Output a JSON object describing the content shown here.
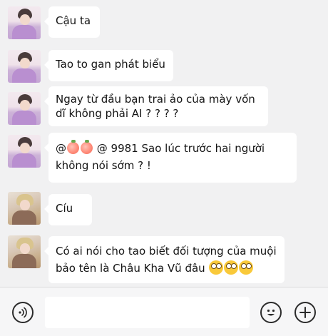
{
  "messages": [
    {
      "avatar": "purple",
      "lines": [
        "Cậu ta"
      ]
    },
    {
      "avatar": "purple",
      "lines": [
        "Tao to gan phát biểu"
      ]
    },
    {
      "avatar": "purple",
      "lines": [
        "Ngay từ đầu bạn trai ảo của mày vốn",
        "dĩ không phải AI ? ? ? ?"
      ]
    },
    {
      "avatar": "purple",
      "mention_prefix": "@",
      "mention_suffix": "@ 9981   Sao lúc trước hai người",
      "lines": [
        "không nói sớm ? !"
      ]
    },
    {
      "avatar": "gold",
      "lines": [
        "Cíu"
      ]
    },
    {
      "avatar": "gold",
      "lines": [
        "Có ai nói cho tao biết đối tượng của muội",
        "bảo tên là Châu Kha Vũ đâu"
      ]
    }
  ],
  "icons": {
    "voice": "voice-icon",
    "emoji": "emoji-icon",
    "plus": "plus-icon",
    "peach": "peach-emoji",
    "eye_roll": "eye-roll-emoji"
  },
  "input": {
    "value": "",
    "placeholder": ""
  },
  "colors": {
    "background": "#f1f1f2",
    "bubble": "#ffffff",
    "text": "#141414"
  }
}
